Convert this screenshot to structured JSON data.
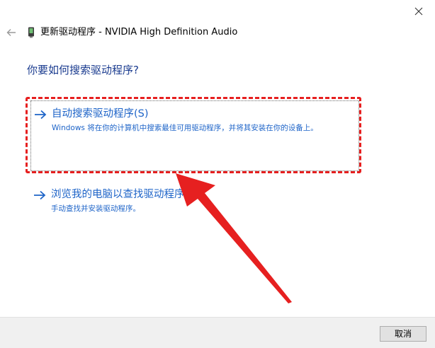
{
  "window": {
    "close_glyph": "✕"
  },
  "header": {
    "title": "更新驱动程序 - NVIDIA High Definition Audio",
    "back_icon": "back-arrow-icon",
    "device_icon": "device-manager-icon"
  },
  "question": "你要如何搜索驱动程序?",
  "options": [
    {
      "title": "自动搜索驱动程序(S)",
      "description": "Windows 将在你的计算机中搜索最佳可用驱动程序，并将其安装在你的设备上。",
      "icon": "right-arrow-icon"
    },
    {
      "title": "浏览我的电脑以查找驱动程序(R)",
      "description": "手动查找并安装驱动程序。",
      "icon": "right-arrow-icon"
    }
  ],
  "footer": {
    "cancel_label": "取消"
  },
  "colors": {
    "link_blue": "#1e64c8",
    "question_blue": "#1a3b8f",
    "annotation_red": "#e62020",
    "footer_bg": "#f0f0f0"
  }
}
